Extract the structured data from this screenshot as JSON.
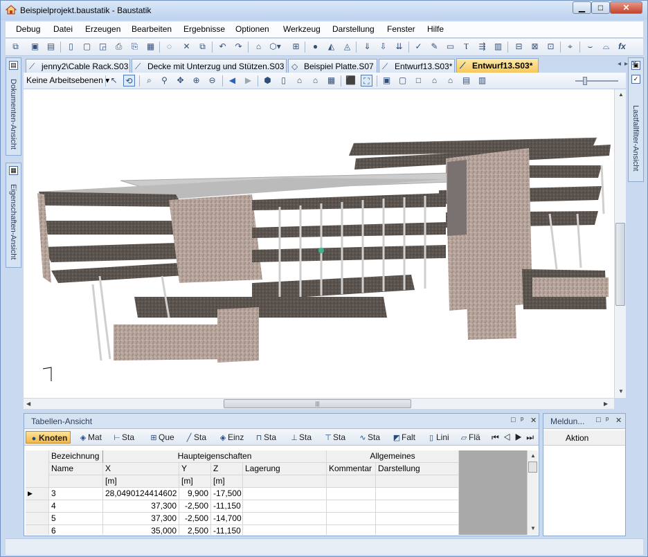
{
  "window": {
    "title": "Beispielprojekt.baustatik - Baustatik",
    "min_label": "▁",
    "max_label": "□",
    "close_label": "✕"
  },
  "menu": [
    "Debug",
    "Datei",
    "Erzeugen",
    "Bearbeiten",
    "Ergebnisse",
    "Optionen",
    "Werkzeug",
    "Darstellung",
    "Fenster",
    "Hilfe"
  ],
  "side_tabs": {
    "documents": "Dokumenten-Ansicht",
    "properties": "Eigenschaften-Ansicht",
    "loadcase_filter": "Lastfallfilter-Ansicht"
  },
  "doc_tabs": [
    {
      "label": "jenny2\\Cable Rack.S03",
      "active": false
    },
    {
      "label": "Decke mit Unterzug und Stützen.S03",
      "active": false
    },
    {
      "label": "Beispiel Platte.S07",
      "active": false
    },
    {
      "label": "Entwurf13.S03*",
      "active": false
    },
    {
      "label": "Entwurf13.S03*",
      "active": true
    }
  ],
  "view_toolbar": {
    "plane_select": "Keine Arbeitsebenen"
  },
  "table_panel": {
    "title": "Tabellen-Ansicht",
    "tabs": [
      {
        "label": "Knoten",
        "icon": "node-icon",
        "active": true
      },
      {
        "label": "Mat",
        "icon": "material-icon",
        "active": false
      },
      {
        "label": "Sta",
        "icon": "bar-icon",
        "active": false
      },
      {
        "label": "Que",
        "icon": "cross-section-icon",
        "active": false
      },
      {
        "label": "Sta",
        "icon": "member-icon",
        "active": false
      },
      {
        "label": "Einz",
        "icon": "single-load-icon",
        "active": false
      },
      {
        "label": "Sta",
        "icon": "distributed-load-icon",
        "active": false
      },
      {
        "label": "Sta",
        "icon": "support-icon",
        "active": false
      },
      {
        "label": "Sta",
        "icon": "beam-load-icon",
        "active": false
      },
      {
        "label": "Sta",
        "icon": "spring-icon",
        "active": false
      },
      {
        "label": "Falt",
        "icon": "fold-icon",
        "active": false
      },
      {
        "label": "Lini",
        "icon": "line-icon",
        "active": false
      },
      {
        "label": "Flä",
        "icon": "area-icon",
        "active": false
      }
    ],
    "group_headers": {
      "designation": "Bezeichnung",
      "main_properties": "Haupteigenschaften",
      "general": "Allgemeines"
    },
    "columns": [
      "Name",
      "X",
      "Y",
      "Z",
      "Lagerung",
      "Kommentar",
      "Darstellung"
    ],
    "units": [
      "",
      "[m]",
      "[m]",
      "[m]",
      "",
      "",
      ""
    ],
    "rows": [
      {
        "name": "3",
        "x": "28,0490124414602",
        "y": "9,900",
        "z": "-17,500",
        "current": true
      },
      {
        "name": "4",
        "x": "37,300",
        "y": "-2,500",
        "z": "-11,150",
        "current": false
      },
      {
        "name": "5",
        "x": "37,300",
        "y": "-2,500",
        "z": "-14,700",
        "current": false
      },
      {
        "name": "6",
        "x": "35,000",
        "y": "2,500",
        "z": "-11,150",
        "current": false
      }
    ]
  },
  "message_panel": {
    "title": "Meldun...",
    "column": "Aktion"
  }
}
